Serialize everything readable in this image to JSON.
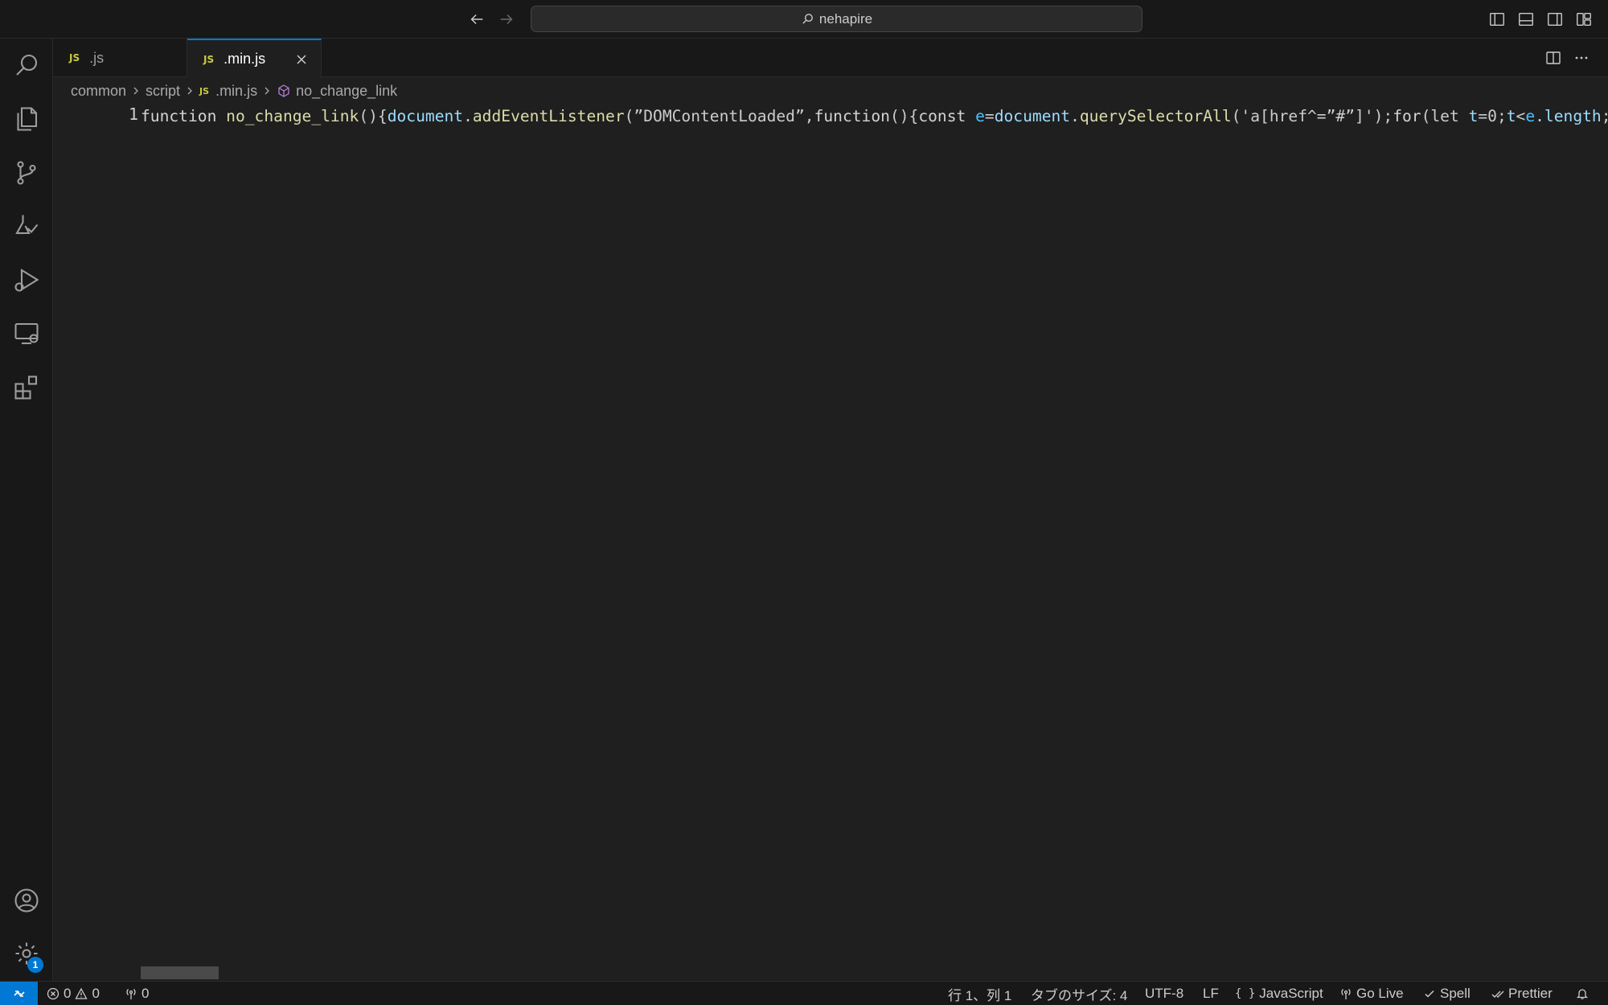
{
  "titlebar": {
    "search_text": "nehapire"
  },
  "tabs": [
    {
      "icon": "JS",
      "label": ".js",
      "active": false
    },
    {
      "icon": "JS",
      "label": ".min.js",
      "active": true
    }
  ],
  "breadcrumb": {
    "items": [
      "common",
      "script",
      ".min.js",
      "no_change_link"
    ],
    "file_icon": "JS"
  },
  "editor": {
    "line_number": "1",
    "code_tokens": [
      [
        "function ",
        "k"
      ],
      [
        "no_change_link",
        "fn"
      ],
      [
        "(){",
        "p"
      ],
      [
        "document",
        "v"
      ],
      [
        ".",
        "p"
      ],
      [
        "addEventListener",
        "fn"
      ],
      [
        "(”DOMContentLoaded”,",
        "p"
      ],
      [
        "function",
        "k"
      ],
      [
        "(){",
        "p"
      ],
      [
        "const ",
        "k"
      ],
      [
        "e",
        "c"
      ],
      [
        "=",
        "p"
      ],
      [
        "document",
        "v"
      ],
      [
        ".",
        "p"
      ],
      [
        "querySelectorAll",
        "fn"
      ],
      [
        "('a[href^=”#”]');",
        "p"
      ],
      [
        "for",
        "k"
      ],
      [
        "(let ",
        "p"
      ],
      [
        "t",
        "v"
      ],
      [
        "=0;",
        "p"
      ],
      [
        "t",
        "v"
      ],
      [
        "<",
        "p"
      ],
      [
        "e",
        "c"
      ],
      [
        ".length",
        "v"
      ],
      [
        ";",
        "p"
      ]
    ]
  },
  "activity_badge": "1",
  "statusbar": {
    "errors": "0",
    "warnings": "0",
    "ports": "0",
    "position": "行 1、列 1",
    "tab_size": "タブのサイズ: 4",
    "encoding": "UTF-8",
    "eol": "LF",
    "language": "JavaScript",
    "go_live": "Go Live",
    "spell": "Spell",
    "prettier": "Prettier"
  },
  "colors": {
    "accent": "#0078d4",
    "background": "#1f1f1f",
    "sidebar": "#181818",
    "js_icon": "#cbcb41"
  }
}
